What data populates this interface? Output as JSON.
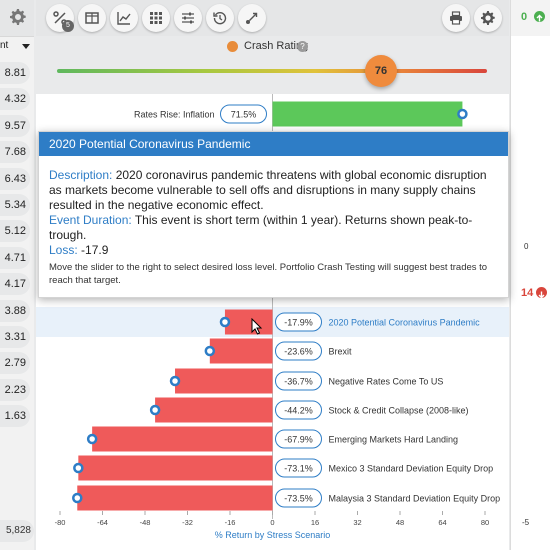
{
  "left_column": {
    "header_icon": "gear-icon",
    "col_name": "nt",
    "values": [
      "8.81",
      "4.32",
      "9.57",
      "7.68",
      "6.43",
      "5.34",
      "5.12",
      "4.71",
      "4.17",
      "3.88",
      "3.31",
      "2.79",
      "2.23",
      "1.63"
    ],
    "bottom_value": "5,828"
  },
  "toolbar": {
    "percent_badge": "5",
    "icons": [
      "percent-icon",
      "columns-icon",
      "line-chart-icon",
      "grid-icon",
      "sliders-icon",
      "history-icon",
      "share-icon"
    ],
    "right_icons": [
      "print-icon",
      "gear-icon"
    ]
  },
  "crash_rating": {
    "label": "Crash Rating",
    "value": "76",
    "level_percent": 76
  },
  "tooltip": {
    "title": "2020 Potential Coronavirus Pandemic",
    "description_key": "Description:",
    "description": "2020 coronavirus pandemic threatens with global economic disruption as markets become vulnerable to sell offs and disruptions in many supply chains resulted in the negative economic effect.",
    "duration_key": "Event Duration:",
    "duration": "This event is short term (within 1 year). Returns shown peak-to-trough.",
    "loss_key": "Loss:",
    "loss": "-17.9",
    "footer": "Move the slider to the right to select desired loss level. Portfolio Crash Testing will suggest best trades to reach that target."
  },
  "right_column": {
    "top_value": "0",
    "mid_value": "14",
    "axis_zero": "0",
    "axis_minus5": "-5"
  },
  "chart_data": {
    "type": "bar",
    "orientation": "horizontal",
    "xlabel": "% Return by Stress Scenario",
    "xlim": [
      -80,
      80
    ],
    "xticks": [
      -80,
      -64,
      -48,
      -32,
      -16,
      0,
      16,
      32,
      48,
      64,
      80
    ],
    "colors": {
      "positive": "#5cc85a",
      "negative": "#ef5a5a",
      "label": "#2e7dc6"
    },
    "series": [
      {
        "scenario": "Rates Rise: Inflation",
        "value": 71.5,
        "label": "71.5%"
      },
      {
        "scenario": "2020 Potential Coronavirus Pandemic",
        "value": -17.9,
        "label": "-17.9%",
        "highlighted": true
      },
      {
        "scenario": "Brexit",
        "value": -23.6,
        "label": "-23.6%"
      },
      {
        "scenario": "Negative Rates Come To US",
        "value": -36.7,
        "label": "-36.7%"
      },
      {
        "scenario": "Stock & Credit Collapse (2008-like)",
        "value": -44.2,
        "label": "-44.2%"
      },
      {
        "scenario": "Emerging Markets Hard Landing",
        "value": -67.9,
        "label": "-67.9%"
      },
      {
        "scenario": "Mexico 3 Standard Deviation Equity Drop",
        "value": -73.1,
        "label": "-73.1%"
      },
      {
        "scenario": "Malaysia 3 Standard Deviation Equity Drop",
        "value": -73.5,
        "label": "-73.5%"
      }
    ]
  }
}
